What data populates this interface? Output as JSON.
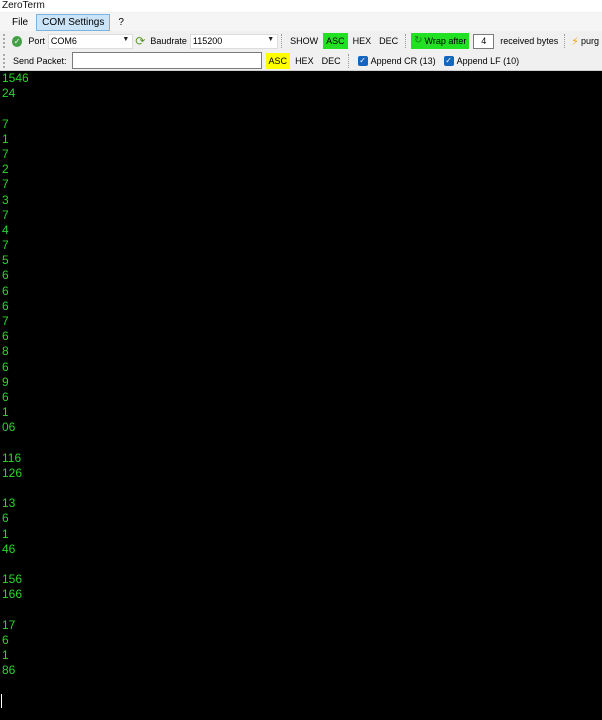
{
  "window": {
    "title": "ZeroTerm"
  },
  "menu": {
    "items": [
      "File",
      "COM Settings",
      "?"
    ]
  },
  "toolbar": {
    "port_label": "Port",
    "port_value": "COM6",
    "baudrate_label": "Baudrate",
    "baudrate_value": "115200",
    "show_label": "SHOW",
    "show_asc": "ASC",
    "show_hex": "HEX",
    "show_dec": "DEC",
    "wrap_label": "Wrap after",
    "wrap_value": "4",
    "received_label": "received bytes",
    "purge_label": "purg"
  },
  "send": {
    "label": "Send Packet:",
    "value": "",
    "asc": "ASC",
    "hex": "HEX",
    "dec": "DEC",
    "append_cr": "Append CR (13)",
    "append_lf": "Append LF (10)"
  },
  "colors": {
    "terminal_bg": "#000000",
    "terminal_text": "#2bd52b",
    "active_green": "#22e022",
    "active_yellow": "#ffff00"
  },
  "terminal": {
    "lines": [
      "1546",
      "24",
      "",
      "7",
      "1",
      "7",
      "2",
      "7",
      "3",
      "7",
      "4",
      "7",
      "5",
      "6",
      "6",
      "6",
      "7",
      "6",
      "8",
      "6",
      "9",
      "6",
      "1",
      "06",
      "",
      "116",
      "126",
      "",
      "13",
      "6",
      "1",
      "46",
      "",
      "156",
      "166",
      "",
      "17",
      "6",
      "1",
      "86",
      "",
      ""
    ]
  }
}
